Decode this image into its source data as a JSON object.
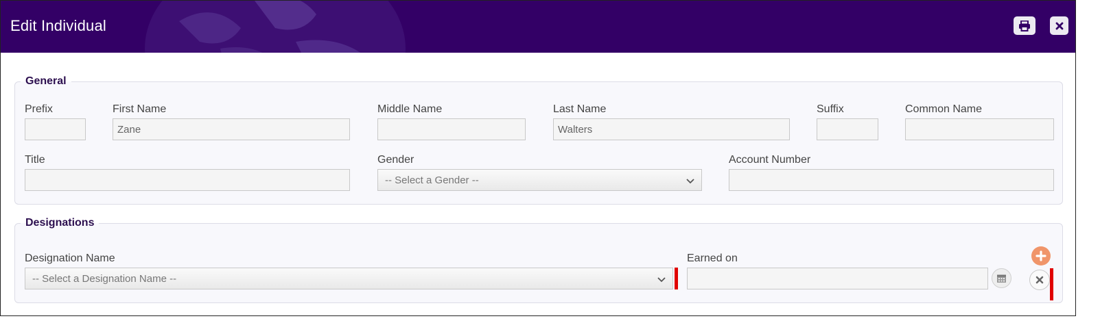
{
  "header": {
    "title": "Edit Individual",
    "background": "#330066",
    "print_icon": "printer-icon",
    "close_icon": "close-icon"
  },
  "general": {
    "legend": "General",
    "prefix": {
      "label": "Prefix",
      "value": ""
    },
    "first_name": {
      "label": "First Name",
      "value": "Zane"
    },
    "middle_name": {
      "label": "Middle Name",
      "value": ""
    },
    "last_name": {
      "label": "Last Name",
      "value": "Walters"
    },
    "suffix": {
      "label": "Suffix",
      "value": ""
    },
    "common_name": {
      "label": "Common Name",
      "value": ""
    },
    "title": {
      "label": "Title",
      "value": ""
    },
    "gender": {
      "label": "Gender",
      "selected": "-- Select a Gender --"
    },
    "account_number": {
      "label": "Account Number",
      "value": ""
    }
  },
  "designations": {
    "legend": "Designations",
    "designation_name": {
      "label": "Designation Name",
      "selected": "-- Select a Designation Name --"
    },
    "earned_on": {
      "label": "Earned on",
      "value": ""
    },
    "add_icon": "plus-circle-icon",
    "remove_icon": "close-circle-icon",
    "calendar_icon": "calendar-icon",
    "accent_color": "#f0956a",
    "required_marker_color": "#e00000"
  }
}
